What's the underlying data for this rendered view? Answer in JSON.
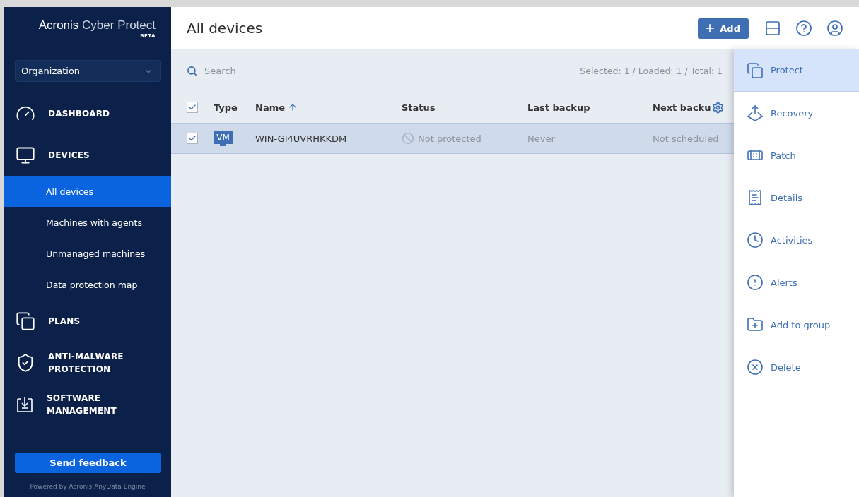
{
  "sidebar": {
    "brand": {
      "name": "Acronis",
      "product": "Cyber Protect",
      "badge": "BETA"
    },
    "tenant_select": {
      "value": "Organization"
    },
    "nav": [
      {
        "label": "DASHBOARD"
      },
      {
        "label": "DEVICES",
        "children": [
          {
            "label": "All devices",
            "selected": true
          },
          {
            "label": "Machines with agents",
            "selected": false
          },
          {
            "label": "Unmanaged machines",
            "selected": false
          },
          {
            "label": "Data protection map",
            "selected": false
          }
        ]
      },
      {
        "label": "PLANS"
      },
      {
        "label": "ANTI-MALWARE PROTECTION"
      },
      {
        "label": "SOFTWARE MANAGEMENT"
      }
    ],
    "feedback_button": "Send feedback",
    "footer": "Powered by Acronis AnyData Engine"
  },
  "header": {
    "title": "All devices",
    "add_button": "Add"
  },
  "toolbar": {
    "search": {
      "placeholder": "Search"
    },
    "counts": "Selected: 1 / Loaded: 1 / Total: 1"
  },
  "table": {
    "select_all": {
      "checked": true
    },
    "columns": [
      {
        "label": "Type"
      },
      {
        "label": "Name",
        "sort_ascending": true
      },
      {
        "label": "Status"
      },
      {
        "label": "Last backup"
      },
      {
        "label": "Next backu"
      }
    ],
    "rows": [
      {
        "checked": true,
        "selected": true,
        "type": "VM",
        "name": "WIN-GI4UVRHKKDM",
        "status": "Not protected",
        "last_backup": "Never",
        "next_backup": "Not scheduled"
      }
    ]
  },
  "actions": [
    {
      "label": "Protect",
      "selected": true
    },
    {
      "label": "Recovery",
      "selected": false
    },
    {
      "label": "Patch",
      "selected": false
    },
    {
      "label": "Details",
      "selected": false
    },
    {
      "label": "Activities",
      "selected": false
    },
    {
      "label": "Alerts",
      "selected": false
    },
    {
      "label": "Add to group",
      "selected": false
    },
    {
      "label": "Delete",
      "selected": false
    }
  ]
}
